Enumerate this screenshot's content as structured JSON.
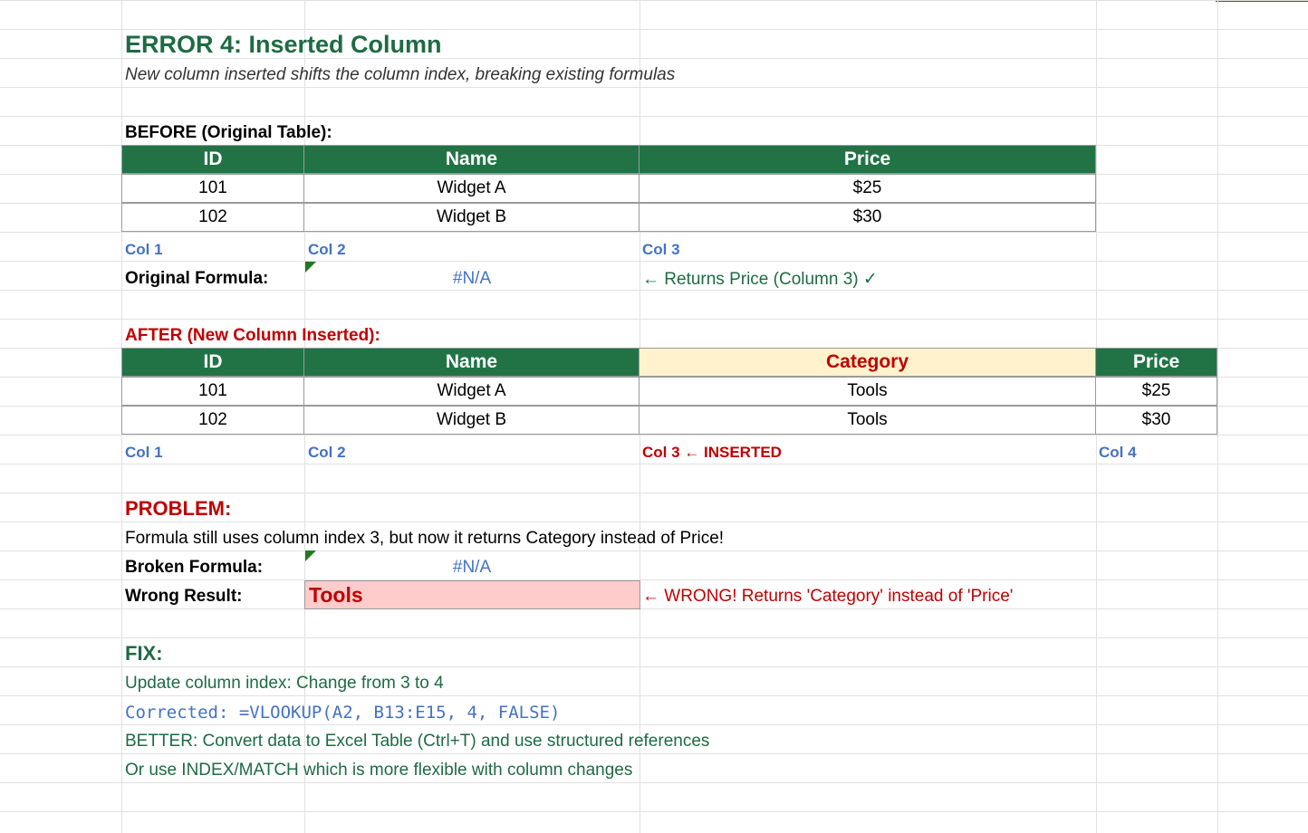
{
  "title": "ERROR 4: Inserted Column",
  "subtitle": "New column inserted shifts the column index, breaking existing formulas",
  "before": {
    "heading": "BEFORE (Original Table):",
    "headers": [
      "ID",
      "Name",
      "Price"
    ],
    "rows": [
      [
        "101",
        "Widget A",
        "$25"
      ],
      [
        "102",
        "Widget B",
        "$30"
      ]
    ],
    "col_labels": [
      "Col 1",
      "Col 2",
      "Col 3"
    ],
    "formula_label": "Original Formula:",
    "formula_value": "#N/A",
    "formula_note": "← Returns Price (Column 3) ✓"
  },
  "after": {
    "heading": "AFTER (New Column Inserted):",
    "headers": [
      "ID",
      "Name",
      "Category",
      "Price"
    ],
    "rows": [
      [
        "101",
        "Widget A",
        "Tools",
        "$25"
      ],
      [
        "102",
        "Widget B",
        "Tools",
        "$30"
      ]
    ],
    "col_labels": [
      "Col 1",
      "Col 2",
      "Col 3 ← INSERTED",
      "Col 4"
    ]
  },
  "problem": {
    "heading": "PROBLEM:",
    "text": "Formula still uses column index 3, but now it returns Category instead of Price!",
    "broken_label": "Broken Formula:",
    "broken_value": "#N/A",
    "wrong_label": "Wrong Result:",
    "wrong_value": "Tools",
    "wrong_note": "← WRONG! Returns 'Category' instead of 'Price'"
  },
  "fix": {
    "heading": "FIX:",
    "lines": [
      "Update column index: Change from 3 to 4",
      "Corrected: =VLOOKUP(A2, B13:E15, 4, FALSE)",
      "BETTER: Convert data to Excel Table (Ctrl+T) and use structured references",
      "Or use INDEX/MATCH which is more flexible with column changes"
    ]
  },
  "colors": {
    "header_green": "#217346",
    "title_green": "#1e6b43",
    "error_red": "#c00000",
    "link_blue": "#4472c4",
    "category_fill": "#fff2cc",
    "wrong_fill": "#ffcccc"
  }
}
